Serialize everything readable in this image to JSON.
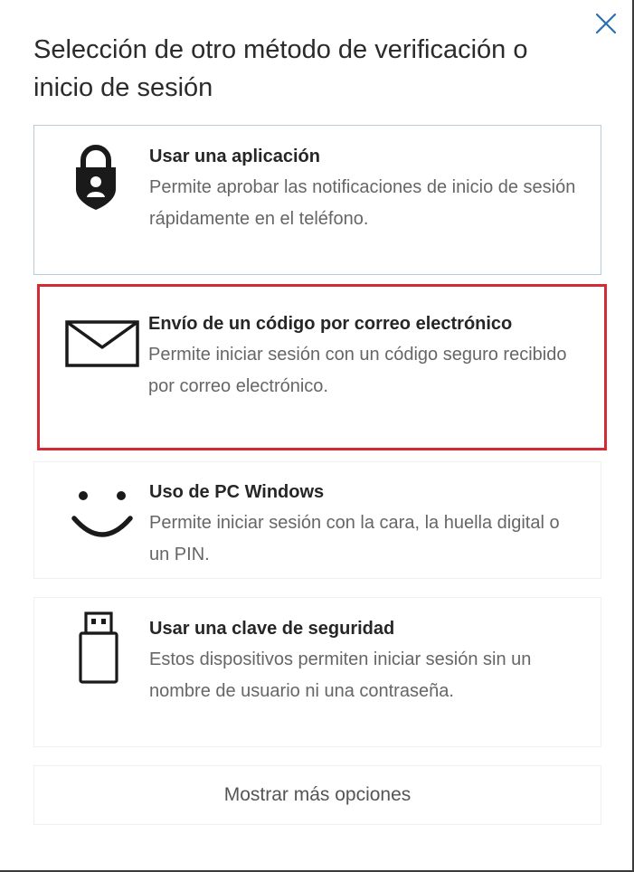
{
  "dialog": {
    "title": "Selección de otro método de verificación o inicio de sesión",
    "close_icon": "close-icon"
  },
  "options": [
    {
      "icon": "lock-icon",
      "title": "Usar una aplicación",
      "description": "Permite aprobar las notificaciones de inicio de sesión rápidamente en el teléfono."
    },
    {
      "icon": "envelope-icon",
      "title": "Envío de un código por correo electrónico",
      "description": "Permite iniciar sesión con un código seguro recibido por correo electrónico.",
      "highlighted": true
    },
    {
      "icon": "smiley-face-icon",
      "title": "Uso de PC Windows",
      "description": "Permite iniciar sesión con la cara, la huella digital o un PIN."
    },
    {
      "icon": "usb-key-icon",
      "title": "Usar una clave de seguridad",
      "description": "Estos dispositivos permiten iniciar sesión sin un nombre de usuario ni una contraseña."
    }
  ],
  "more_options_label": "Mostrar más opciones",
  "colors": {
    "accent": "#0067b8",
    "highlight_border": "#d42a35",
    "selected_border": "#b7ccdc"
  }
}
